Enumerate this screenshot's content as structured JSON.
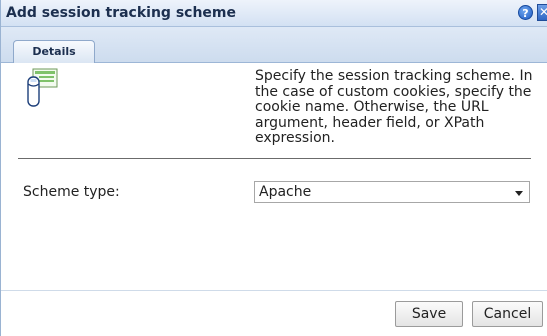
{
  "dialog": {
    "title": "Add session tracking scheme",
    "help_icon": "help-icon",
    "help_glyph": "?",
    "close_icon": "close-icon",
    "close_glyph": "✕"
  },
  "tabs": [
    {
      "label": "Details",
      "selected": true
    }
  ],
  "content": {
    "icon": "session-tracking-icon",
    "description": "Specify the session tracking scheme. In the case of custom cookies, specify the cookie name. Otherwise, the URL argument, header field, or XPath expression."
  },
  "form": {
    "scheme_type_label": "Scheme type:",
    "scheme_type_value": "Apache"
  },
  "footer": {
    "save_label": "Save",
    "cancel_label": "Cancel"
  },
  "colors": {
    "title_bar": "#d3e1f3",
    "title_text": "#1c2f4f",
    "help_button": "#1f5cc4"
  }
}
